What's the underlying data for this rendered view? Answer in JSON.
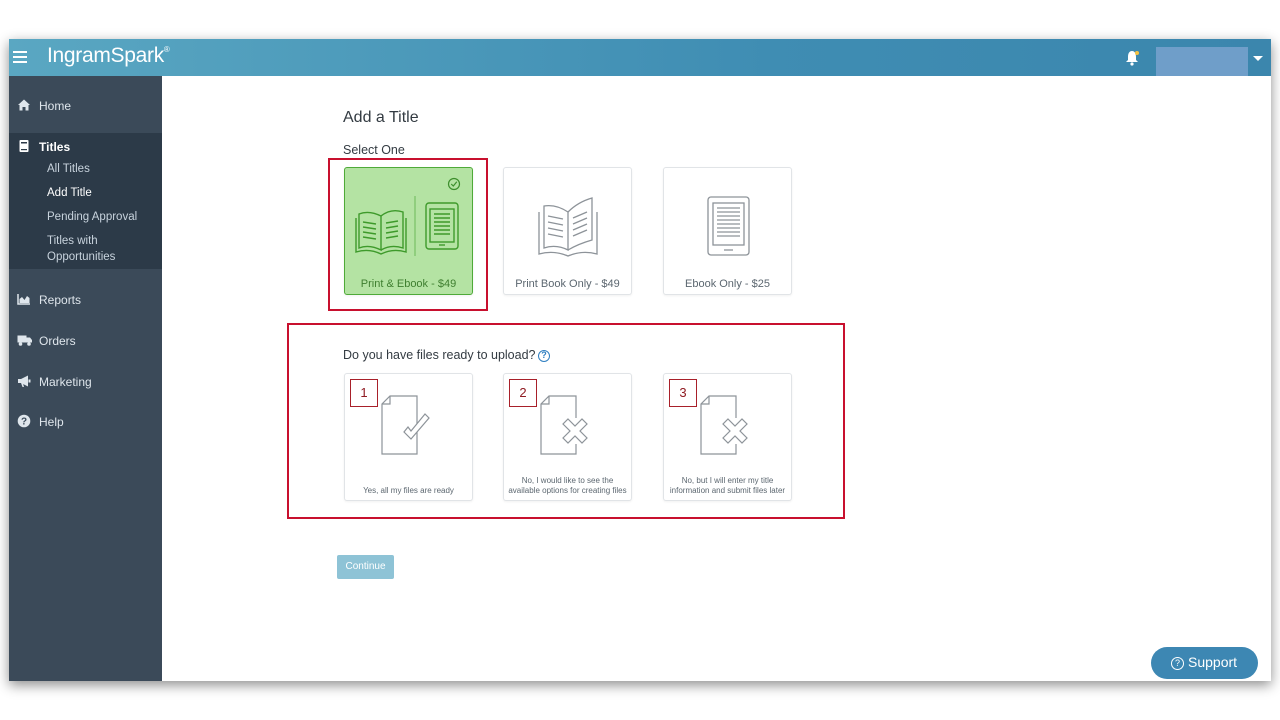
{
  "app": {
    "brand": "IngramSpark",
    "brand_mark": "®"
  },
  "sidebar": {
    "items": [
      {
        "label": "Home",
        "icon": "home-icon"
      },
      {
        "label": "Titles",
        "icon": "book-icon"
      },
      {
        "label": "Reports",
        "icon": "chart-icon"
      },
      {
        "label": "Orders",
        "icon": "truck-icon"
      },
      {
        "label": "Marketing",
        "icon": "megaphone-icon"
      },
      {
        "label": "Help",
        "icon": "question-icon"
      }
    ],
    "titles_sub": [
      "All Titles",
      "Add Title",
      "Pending Approval",
      "Titles with",
      "Opportunities"
    ]
  },
  "main": {
    "title": "Add a Title",
    "select_prompt": "Select One",
    "format_options": [
      {
        "label": "Print & Ebook - $49",
        "selected": true
      },
      {
        "label": "Print Book Only - $49",
        "selected": false
      },
      {
        "label": "Ebook Only - $25",
        "selected": false
      }
    ],
    "files_question": "Do you have files ready to upload?",
    "help_glyph": "?",
    "file_options": [
      {
        "number": "1",
        "text": "Yes, all my files are ready"
      },
      {
        "number": "2",
        "text": "No, I would like to see the available options for creating files"
      },
      {
        "number": "3",
        "text": "No, but I will enter my title information and submit files later"
      }
    ],
    "continue_label": "Continue"
  },
  "support": {
    "label": "Support",
    "glyph": "?"
  },
  "colors": {
    "topbar": "#4296bb",
    "sidebar": "#3b4a59",
    "selected_card": "#b4e3a3",
    "highlight": "#c8102e"
  }
}
